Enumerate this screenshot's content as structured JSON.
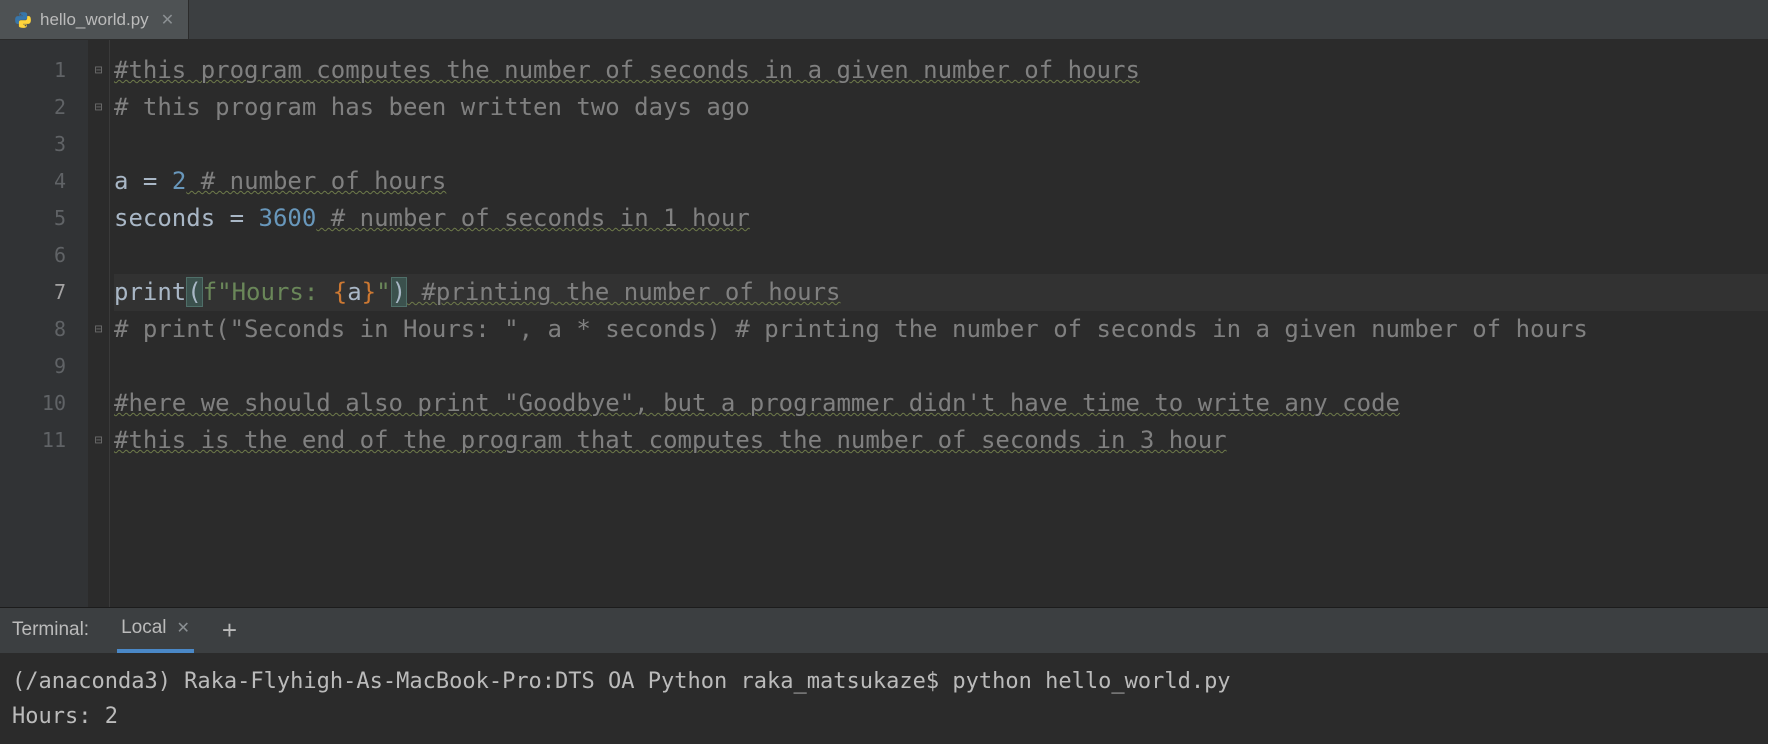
{
  "tabs": {
    "file_name": "hello_world.py"
  },
  "editor": {
    "current_line": 7,
    "lines": {
      "l1": {
        "num": "1",
        "fold": "⊟",
        "comment": "#this program computes the number of seconds in a given number of hours"
      },
      "l2": {
        "num": "2",
        "fold": "⊟",
        "comment": "# this program has been written two days ago"
      },
      "l3": {
        "num": "3",
        "fold": ""
      },
      "l4": {
        "num": "4",
        "fold": "",
        "var": "a",
        "eq": " = ",
        "val": "2",
        "trail_comment": " # number of hours"
      },
      "l5": {
        "num": "5",
        "fold": "",
        "var": "seconds",
        "eq": " = ",
        "val": "3600",
        "trail_comment": " # number of seconds in 1 hour"
      },
      "l6": {
        "num": "6",
        "fold": ""
      },
      "l7": {
        "num": "7",
        "fold": "",
        "func": "print",
        "open": "(",
        "fprefix": "f",
        "str1": "\"Hours: ",
        "lbrace": "{",
        "fvar": "a",
        "rbrace": "}",
        "str2": "\"",
        "close": ")",
        "trail_comment": " #printing the number of hours"
      },
      "l8": {
        "num": "8",
        "fold": "⊟",
        "comment": "# print(\"Seconds in Hours: \", a * seconds) # printing the number of seconds in a given number of hours"
      },
      "l9": {
        "num": "9",
        "fold": ""
      },
      "l10": {
        "num": "10",
        "fold": "",
        "comment": "#here we should also print \"Goodbye\", but a programmer didn't have time to write any code"
      },
      "l11": {
        "num": "11",
        "fold": "⊟",
        "comment": "#this is the end of the program that computes the number of seconds in 3 hour"
      }
    }
  },
  "terminal": {
    "title": "Terminal:",
    "tab_label": "Local",
    "prompt": "(/anaconda3) Raka-Flyhigh-As-MacBook-Pro:DTS OA Python raka_matsukaze$ ",
    "command": "python hello_world.py",
    "output_line1": "Hours: 2"
  }
}
